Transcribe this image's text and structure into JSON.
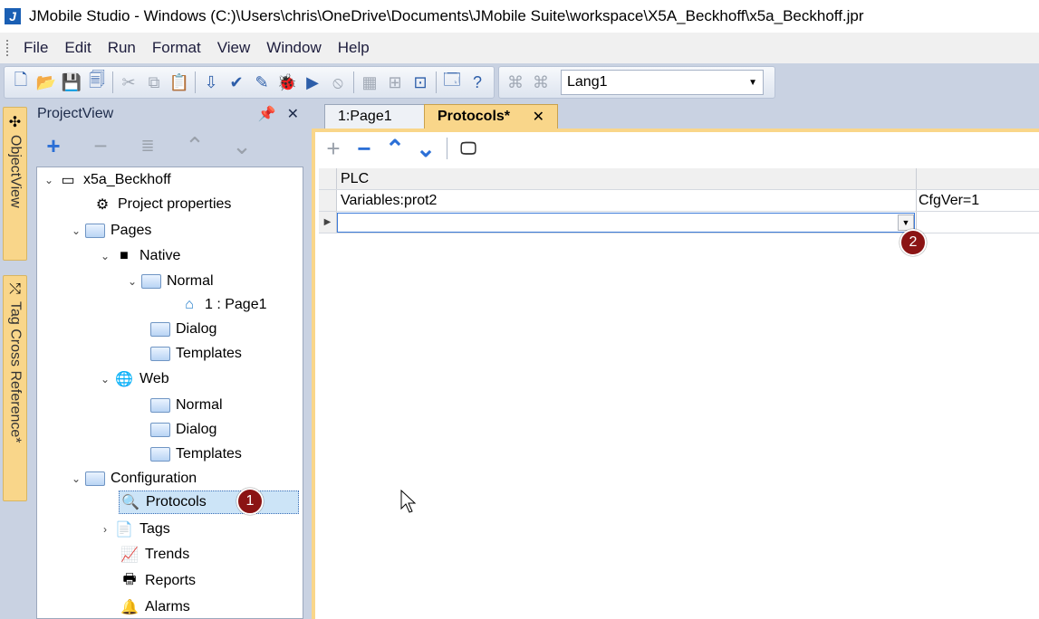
{
  "titlebar": {
    "logo": "J",
    "title": "JMobile Studio - Windows (C:)\\Users\\chris\\OneDrive\\Documents\\JMobile Suite\\workspace\\X5A_Beckhoff\\x5a_Beckhoff.jpr"
  },
  "menu": [
    "File",
    "Edit",
    "Run",
    "Format",
    "View",
    "Window",
    "Help"
  ],
  "toolbar": {
    "language": "Lang1"
  },
  "side_tabs": [
    "ObjectView",
    "Tag Cross Reference*"
  ],
  "project_view": {
    "title": "ProjectView",
    "tree": [
      {
        "label": "x5a_Beckhoff",
        "icon": "device-icon"
      },
      {
        "label": "Project properties",
        "icon": "properties-icon"
      },
      {
        "label": "Pages",
        "icon": "folder-icon"
      },
      {
        "label": "Native",
        "icon": "monitor-icon"
      },
      {
        "label": "Normal",
        "icon": "folder-icon"
      },
      {
        "label": "1 : Page1",
        "icon": "home-icon"
      },
      {
        "label": "Dialog",
        "icon": "folder-icon"
      },
      {
        "label": "Templates",
        "icon": "folder-icon"
      },
      {
        "label": "Web",
        "icon": "globe-icon"
      },
      {
        "label": "Normal",
        "icon": "folder-icon"
      },
      {
        "label": "Dialog",
        "icon": "folder-icon"
      },
      {
        "label": "Templates",
        "icon": "folder-icon"
      },
      {
        "label": "Configuration",
        "icon": "folder-icon"
      },
      {
        "label": "Protocols",
        "icon": "protocols-icon"
      },
      {
        "label": "Tags",
        "icon": "tags-icon"
      },
      {
        "label": "Trends",
        "icon": "trends-icon"
      },
      {
        "label": "Reports",
        "icon": "printer-icon"
      },
      {
        "label": "Alarms",
        "icon": "bell-icon"
      }
    ]
  },
  "editor": {
    "tabs": [
      "1:Page1",
      "Protocols*"
    ],
    "grid": {
      "columns": [
        "PLC",
        ""
      ],
      "rows": [
        [
          "Variables:prot2",
          "CfgVer=1"
        ]
      ]
    }
  },
  "badges": [
    "1",
    "2"
  ]
}
